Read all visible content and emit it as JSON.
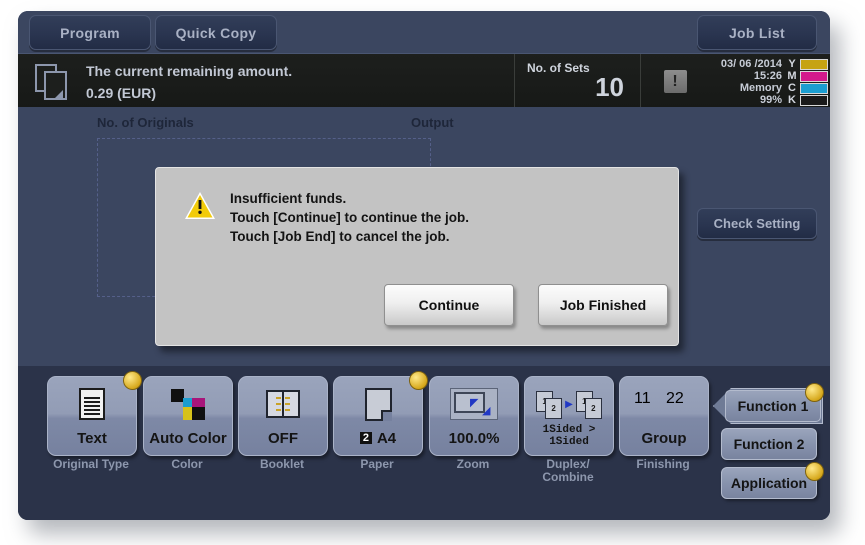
{
  "topbar": {
    "program_label": "Program",
    "quick_copy_label": "Quick Copy",
    "job_list_label": "Job List"
  },
  "status": {
    "icon": "copy-sheets-icon",
    "title": "The current remaining amount.",
    "amount": "0.29 (EUR)",
    "sets_label": "No. of Sets",
    "sets_value": "10",
    "alert_icon": "exclamation-icon",
    "date": "03/ 06 /2014",
    "time": "15:26",
    "memory_label": "Memory",
    "memory_value": "99%",
    "toner": [
      {
        "letter": "Y",
        "color": "#c6a313"
      },
      {
        "letter": "M",
        "color": "#d41a8c"
      },
      {
        "letter": "C",
        "color": "#1b9dd0"
      },
      {
        "letter": "K",
        "color": "#1a1a1a"
      }
    ],
    "check_setting_label": "Check Setting"
  },
  "main": {
    "originals_label": "No. of Originals",
    "output_label": "Output"
  },
  "dialog": {
    "icon": "warning-triangle-icon",
    "line1": "Insufficient funds.",
    "line2": "Touch [Continue] to continue the job.",
    "line3": "Touch [Job End] to cancel the job.",
    "continue_label": "Continue",
    "job_finished_label": "Job Finished"
  },
  "functions": [
    {
      "value": "Text",
      "caption": "Original Type",
      "icon": "document-lines-icon",
      "badge": true
    },
    {
      "value": "Auto Color",
      "caption": "Color",
      "icon": "cmyk-squares-icon",
      "badge": false
    },
    {
      "value": "OFF",
      "caption": "Booklet",
      "icon": "open-book-icon",
      "badge": false
    },
    {
      "value": "A4",
      "caption": "Paper",
      "icon": "paper-sheet-icon",
      "badge": true,
      "tray": "2"
    },
    {
      "value": "100.0%",
      "caption": "Zoom",
      "icon": "zoom-arrows-icon",
      "badge": false
    },
    {
      "value": "1Sided > 1Sided",
      "caption": "Duplex/ Combine",
      "icon": "duplex-pages-icon",
      "badge": false
    },
    {
      "value": "Group",
      "caption": "Finishing",
      "icon": "group-pages-icon",
      "badge": false
    }
  ],
  "side_buttons": {
    "function1_label": "Function 1",
    "function2_label": "Function 2",
    "application_label": "Application"
  },
  "colors": {
    "screen_bg": "#3b4660",
    "bottom_bg": "#2b3349",
    "accent_yellow": "#e0b521",
    "dialog_bg": "#c3c3c3"
  }
}
